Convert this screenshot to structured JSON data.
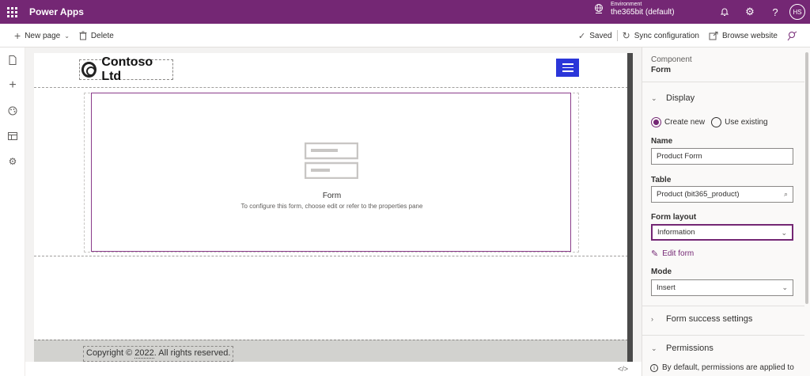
{
  "topbar": {
    "app_name": "Power Apps",
    "env_label": "Environment",
    "env_name": "the365bit (default)",
    "avatar_initials": "HS",
    "accent": "#742774"
  },
  "cmdbar": {
    "new_page": "New page",
    "delete": "Delete",
    "saved": "Saved",
    "sync": "Sync configuration",
    "browse": "Browse website"
  },
  "canvas": {
    "logo_text": "Contoso Ltd",
    "form_title": "Form",
    "form_hint": "To configure this form, choose edit or refer to the properties pane",
    "footer_prefix": "Copyright © ",
    "footer_year": "2022",
    "footer_suffix": ". All rights reserved.",
    "menu_color": "#2b36d9"
  },
  "panel": {
    "component_label": "Component",
    "component_value": "Form",
    "display_section": "Display",
    "radio_create": "Create new",
    "radio_existing": "Use existing",
    "name_label": "Name",
    "name_value": "Product Form",
    "table_label": "Table",
    "table_value": "Product (bit365_product)",
    "form_layout_label": "Form layout",
    "form_layout_value": "Information",
    "edit_form": "Edit form",
    "mode_label": "Mode",
    "mode_value": "Insert",
    "success_section": "Form success settings",
    "permissions_section": "Permissions",
    "permissions_info": "By default, permissions are applied to"
  }
}
